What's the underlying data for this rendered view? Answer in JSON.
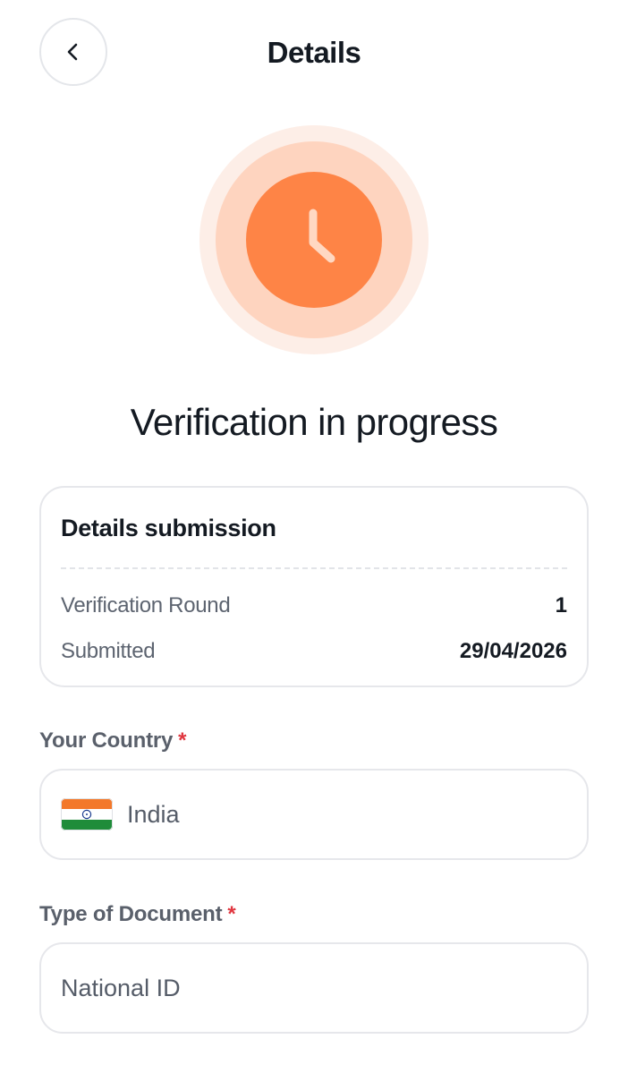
{
  "header": {
    "title": "Details",
    "back_icon": "chevron-left-icon"
  },
  "status": {
    "icon": "clock-icon",
    "heading": "Verification in progress",
    "colors": {
      "outer_ring": "#fdeee7",
      "middle_ring": "#fed4bf",
      "inner_circle": "#fe8446",
      "hands": "#ffd8c2"
    }
  },
  "submission_card": {
    "title": "Details submission",
    "rows": [
      {
        "label": "Verification Round",
        "value": "1"
      },
      {
        "label": "Submitted",
        "value": "29/04/2026"
      }
    ]
  },
  "country_field": {
    "label": "Your Country",
    "required_mark": "*",
    "value": "India",
    "flag_icon": "india-flag-icon"
  },
  "document_field": {
    "label": "Type of Document",
    "required_mark": "*",
    "value": "National ID"
  }
}
